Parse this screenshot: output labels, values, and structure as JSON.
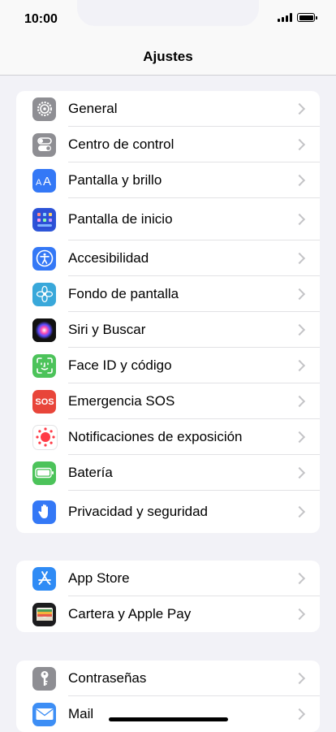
{
  "status": {
    "time": "10:00"
  },
  "nav": {
    "title": "Ajustes"
  },
  "groups": [
    {
      "items": [
        {
          "label": "General",
          "icon": "gear-icon",
          "color": "#8e8e93"
        },
        {
          "label": "Centro de control",
          "icon": "toggles-icon",
          "color": "#8e8e93"
        },
        {
          "label": "Pantalla y brillo",
          "icon": "text-size-icon",
          "color": "#3478f6"
        },
        {
          "label": "Pantalla de inicio",
          "icon": "home-grid-icon",
          "color": "#2d55d8"
        },
        {
          "label": "Accesibilidad",
          "icon": "accessibility-icon",
          "color": "#3478f6"
        },
        {
          "label": "Fondo de pantalla",
          "icon": "flower-icon",
          "color": "#39a8da"
        },
        {
          "label": "Siri y Buscar",
          "icon": "siri-icon",
          "color": "#1c1c1e"
        },
        {
          "label": "Face ID y código",
          "icon": "face-id-icon",
          "color": "#4cc35a"
        },
        {
          "label": "Emergencia SOS",
          "icon": "sos-icon",
          "color": "#e8453a",
          "text": "SOS"
        },
        {
          "label": "Notificaciones de exposición",
          "icon": "exposure-icon",
          "color": "#ffffff"
        },
        {
          "label": "Batería",
          "icon": "battery-icon",
          "color": "#4cc35a"
        },
        {
          "label": "Privacidad y seguridad",
          "icon": "hand-icon",
          "color": "#3478f6"
        }
      ]
    },
    {
      "items": [
        {
          "label": "App Store",
          "icon": "app-store-icon",
          "color": "#2f8bf5"
        },
        {
          "label": "Cartera y Apple Pay",
          "icon": "wallet-icon",
          "color": "#1c1c1e"
        }
      ]
    },
    {
      "items": [
        {
          "label": "Contraseñas",
          "icon": "key-icon",
          "color": "#8e8e93"
        },
        {
          "label": "Mail",
          "icon": "mail-icon",
          "color": "#3d8ef5"
        }
      ]
    }
  ]
}
